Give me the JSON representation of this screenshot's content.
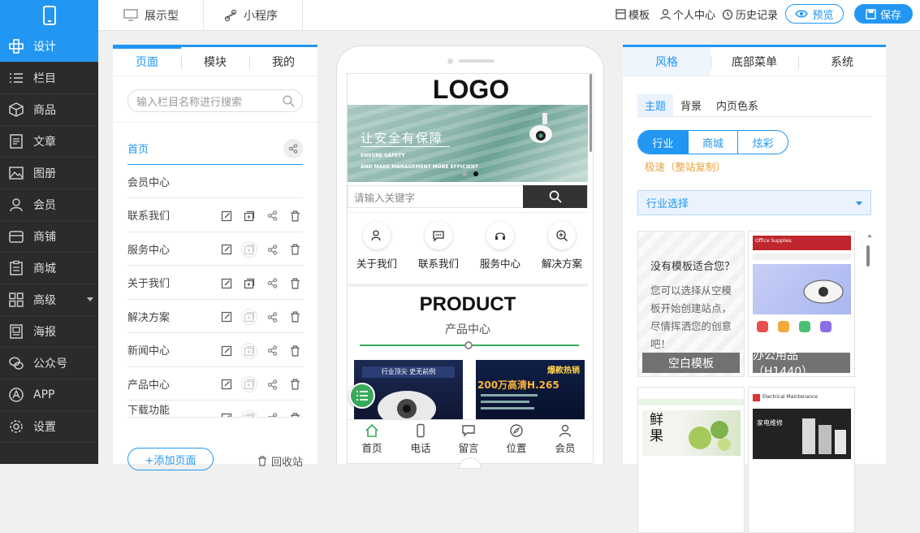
{
  "topbar": {
    "mode_display": "展示型",
    "mode_miniprogram": "小程序",
    "template": "模板",
    "personal_center": "个人中心",
    "history": "历史记录",
    "preview": "预览",
    "save": "保存"
  },
  "sidebar": {
    "items": [
      {
        "label": "设计",
        "icon": "design-icon"
      },
      {
        "label": "栏目",
        "icon": "list-icon"
      },
      {
        "label": "商品",
        "icon": "box-icon"
      },
      {
        "label": "文章",
        "icon": "article-icon"
      },
      {
        "label": "图册",
        "icon": "image-icon"
      },
      {
        "label": "会员",
        "icon": "user-icon"
      },
      {
        "label": "商铺",
        "icon": "shop-icon"
      },
      {
        "label": "商城",
        "icon": "mall-icon"
      },
      {
        "label": "高级",
        "icon": "grid-icon"
      },
      {
        "label": "海报",
        "icon": "poster-icon"
      },
      {
        "label": "公众号",
        "icon": "wechat-icon"
      },
      {
        "label": "APP",
        "icon": "app-icon"
      },
      {
        "label": "设置",
        "icon": "gear-icon"
      }
    ]
  },
  "left_panel": {
    "tabs": [
      "页面",
      "模块",
      "我的"
    ],
    "search_placeholder": "输入栏目名称进行搜索",
    "pages": [
      "首页",
      "会员中心",
      "联系我们",
      "服务中心",
      "关于我们",
      "解决方案",
      "新闻中心",
      "产品中心",
      "下载功能"
    ],
    "add_page": "+添加页面",
    "recycle": "回收站"
  },
  "phone": {
    "logo": "LOGO",
    "banner_title": "让安全有保障",
    "banner_sub1": "ENSURE SAFETY",
    "banner_sub2": "AND MAKE MANAGEMENT MORE EFFICIENT",
    "search_placeholder": "请输入关键字",
    "nav": [
      "关于我们",
      "联系我们",
      "服务中心",
      "解决方案"
    ],
    "product_title": "PRODUCT",
    "product_subtitle": "产品中心",
    "product1_caption": "行业顶尖 史无前例",
    "product2_tag": "爆款热销",
    "product2_price": "200万高清H.265",
    "tabbar": [
      "首页",
      "电话",
      "留言",
      "位置",
      "会员"
    ]
  },
  "right_panel": {
    "tabs": [
      "风格",
      "底部菜单",
      "系统"
    ],
    "subtabs": [
      "主题",
      "背景",
      "内页色系"
    ],
    "segments": [
      "行业",
      "商城",
      "炫彩"
    ],
    "speed_note": "极速（整站复制）",
    "industry_select": "行业选择",
    "blank_title": "没有模板适合您？",
    "blank_desc": "您可以选择从空模板开始创建站点，尽情挥洒您的创意吧！",
    "template1_label": "空白模板",
    "template2_label": "办公用品（H1440）",
    "template2_header": "Office Supplies",
    "template3_word": "鲜果",
    "template4_header": "Electrical Maintenance",
    "template4_banner": "家电维修"
  },
  "colors": {
    "accent": "#2196f3",
    "sidebar": "#2b2b2b",
    "green": "#3aaa5a",
    "orange": "#e6a23c"
  }
}
